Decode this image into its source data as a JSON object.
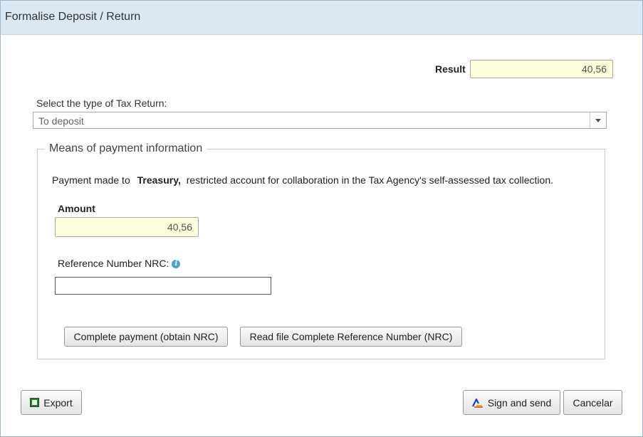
{
  "dialog": {
    "title": "Formalise Deposit / Return"
  },
  "result": {
    "label": "Result",
    "value": "40,56"
  },
  "tax_return_type": {
    "label": "Select the type of Tax Return:",
    "selected": "To deposit"
  },
  "means_of_payment": {
    "legend": "Means of payment information",
    "text_prefix": "Payment made to",
    "text_bold": "Treasury,",
    "text_suffix": "restricted account for collaboration in the Tax Agency's self-assessed tax collection.",
    "amount_label": "Amount",
    "amount_value": "40,56",
    "nrc_label": "Reference Number NRC:",
    "nrc_value": "",
    "complete_payment_label": "Complete payment (obtain NRC)",
    "read_file_label": "Read file Complete Reference Number (NRC)"
  },
  "footer": {
    "export_label": "Export",
    "sign_send_label": "Sign and send",
    "cancel_label": "Cancelar"
  },
  "colors": {
    "title_bar": "#dbe7f1",
    "readonly_input": "#fdfcdc",
    "info_icon": "#4aa3c8"
  }
}
